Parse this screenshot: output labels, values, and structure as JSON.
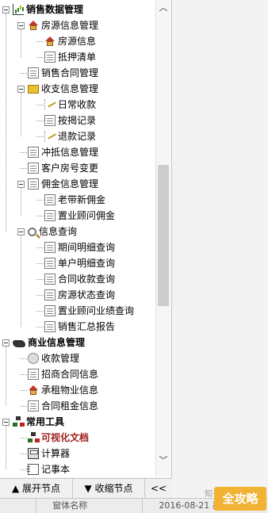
{
  "tree": [
    {
      "label": "销售数据管理",
      "level": 0,
      "icon": "chart-icon",
      "bold": true
    },
    {
      "label": "房源信息管理",
      "level": 1,
      "icon": "house-icon"
    },
    {
      "label": "房源信息",
      "level": 2,
      "icon": "house-icon"
    },
    {
      "label": "抵押清单",
      "level": 2,
      "icon": "document-icon"
    },
    {
      "label": "销售合同管理",
      "level": 1,
      "icon": "document-icon"
    },
    {
      "label": "收支信息管理",
      "level": 1,
      "icon": "envelope-icon"
    },
    {
      "label": "日常收款",
      "level": 2,
      "icon": "pen-icon"
    },
    {
      "label": "按揭记录",
      "level": 2,
      "icon": "document-icon"
    },
    {
      "label": "退款记录",
      "level": 2,
      "icon": "pen-icon"
    },
    {
      "label": "冲抵信息管理",
      "level": 1,
      "icon": "document-icon"
    },
    {
      "label": "客户房号变更",
      "level": 1,
      "icon": "document-icon"
    },
    {
      "label": "佣金信息管理",
      "level": 1,
      "icon": "document-icon"
    },
    {
      "label": "老带新佣金",
      "level": 2,
      "icon": "document-icon"
    },
    {
      "label": "置业顾问佣金",
      "level": 2,
      "icon": "document-icon"
    },
    {
      "label": "信息查询",
      "level": 1,
      "icon": "magnifier-icon"
    },
    {
      "label": "期间明细查询",
      "level": 2,
      "icon": "document-icon"
    },
    {
      "label": "单户明细查询",
      "level": 2,
      "icon": "document-icon"
    },
    {
      "label": "合同收款查询",
      "level": 2,
      "icon": "document-icon"
    },
    {
      "label": "房源状态查询",
      "level": 2,
      "icon": "document-icon"
    },
    {
      "label": "置业顾问业绩查询",
      "level": 2,
      "icon": "document-icon"
    },
    {
      "label": "销售汇总报告",
      "level": 2,
      "icon": "document-icon"
    },
    {
      "label": "商业信息管理",
      "level": 0,
      "icon": "handshake-icon",
      "bold": true
    },
    {
      "label": "收款管理",
      "level": 1,
      "icon": "coins-icon"
    },
    {
      "label": "招商合同信息",
      "level": 1,
      "icon": "document-icon"
    },
    {
      "label": "承租物业信息",
      "level": 1,
      "icon": "house-icon"
    },
    {
      "label": "合同租金信息",
      "level": 1,
      "icon": "document-icon"
    },
    {
      "label": "常用工具",
      "level": 0,
      "icon": "tools-icon",
      "bold": true
    },
    {
      "label": "可视化文档",
      "level": 1,
      "icon": "tree-icon",
      "highlight": true
    },
    {
      "label": "计算器",
      "level": 1,
      "icon": "calculator-icon"
    },
    {
      "label": "记事本",
      "level": 1,
      "icon": "notepad-icon"
    }
  ],
  "toolbar": {
    "expand": "▲ 展开节点",
    "collapse": "▼ 收缩节点",
    "toggle": "<<"
  },
  "statusbar": {
    "left": "",
    "middle": "窗体名称",
    "right": "2016-08-21 星期六"
  },
  "watermark": "知乎",
  "logo": "全攻略",
  "colors": {
    "highlight": "#a02020",
    "logo": "#f2b233"
  }
}
